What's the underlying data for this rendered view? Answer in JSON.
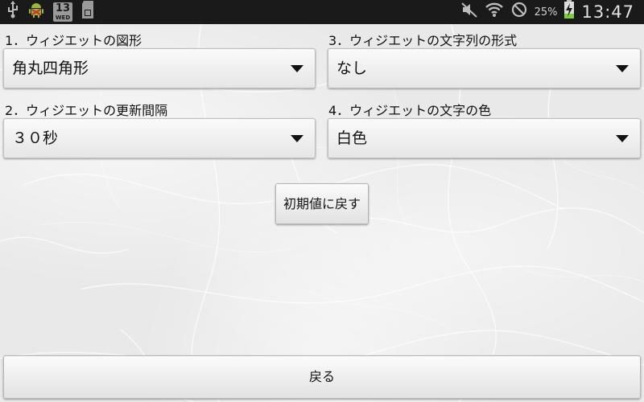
{
  "status_bar": {
    "left_icons": [
      "usb-icon",
      "android-debug-icon",
      "calendar-icon",
      "sd-card-icon"
    ],
    "calendar_day_number": "13",
    "calendar_weekday": "WED",
    "right_icons": [
      "mute-icon",
      "wifi-icon",
      "no-signal-icon",
      "battery-charging-icon"
    ],
    "battery_percent": "25%",
    "time": "13:47"
  },
  "settings": {
    "shape_label": "1．ウィジエットの図形",
    "shape_value": "角丸四角形",
    "format_label": "3．ウィジエットの文字列の形式",
    "format_value": "なし",
    "interval_label": "2．ウィジエットの更新間隔",
    "interval_value": "３０秒",
    "color_label": "4．ウィジエットの文字の色",
    "color_value": "白色"
  },
  "buttons": {
    "reset_label": "初期値に戻す",
    "back_label": "戻る"
  },
  "colors": {
    "status_bar_bg": "#1a1a1a",
    "battery_green": "#7fd13b"
  }
}
